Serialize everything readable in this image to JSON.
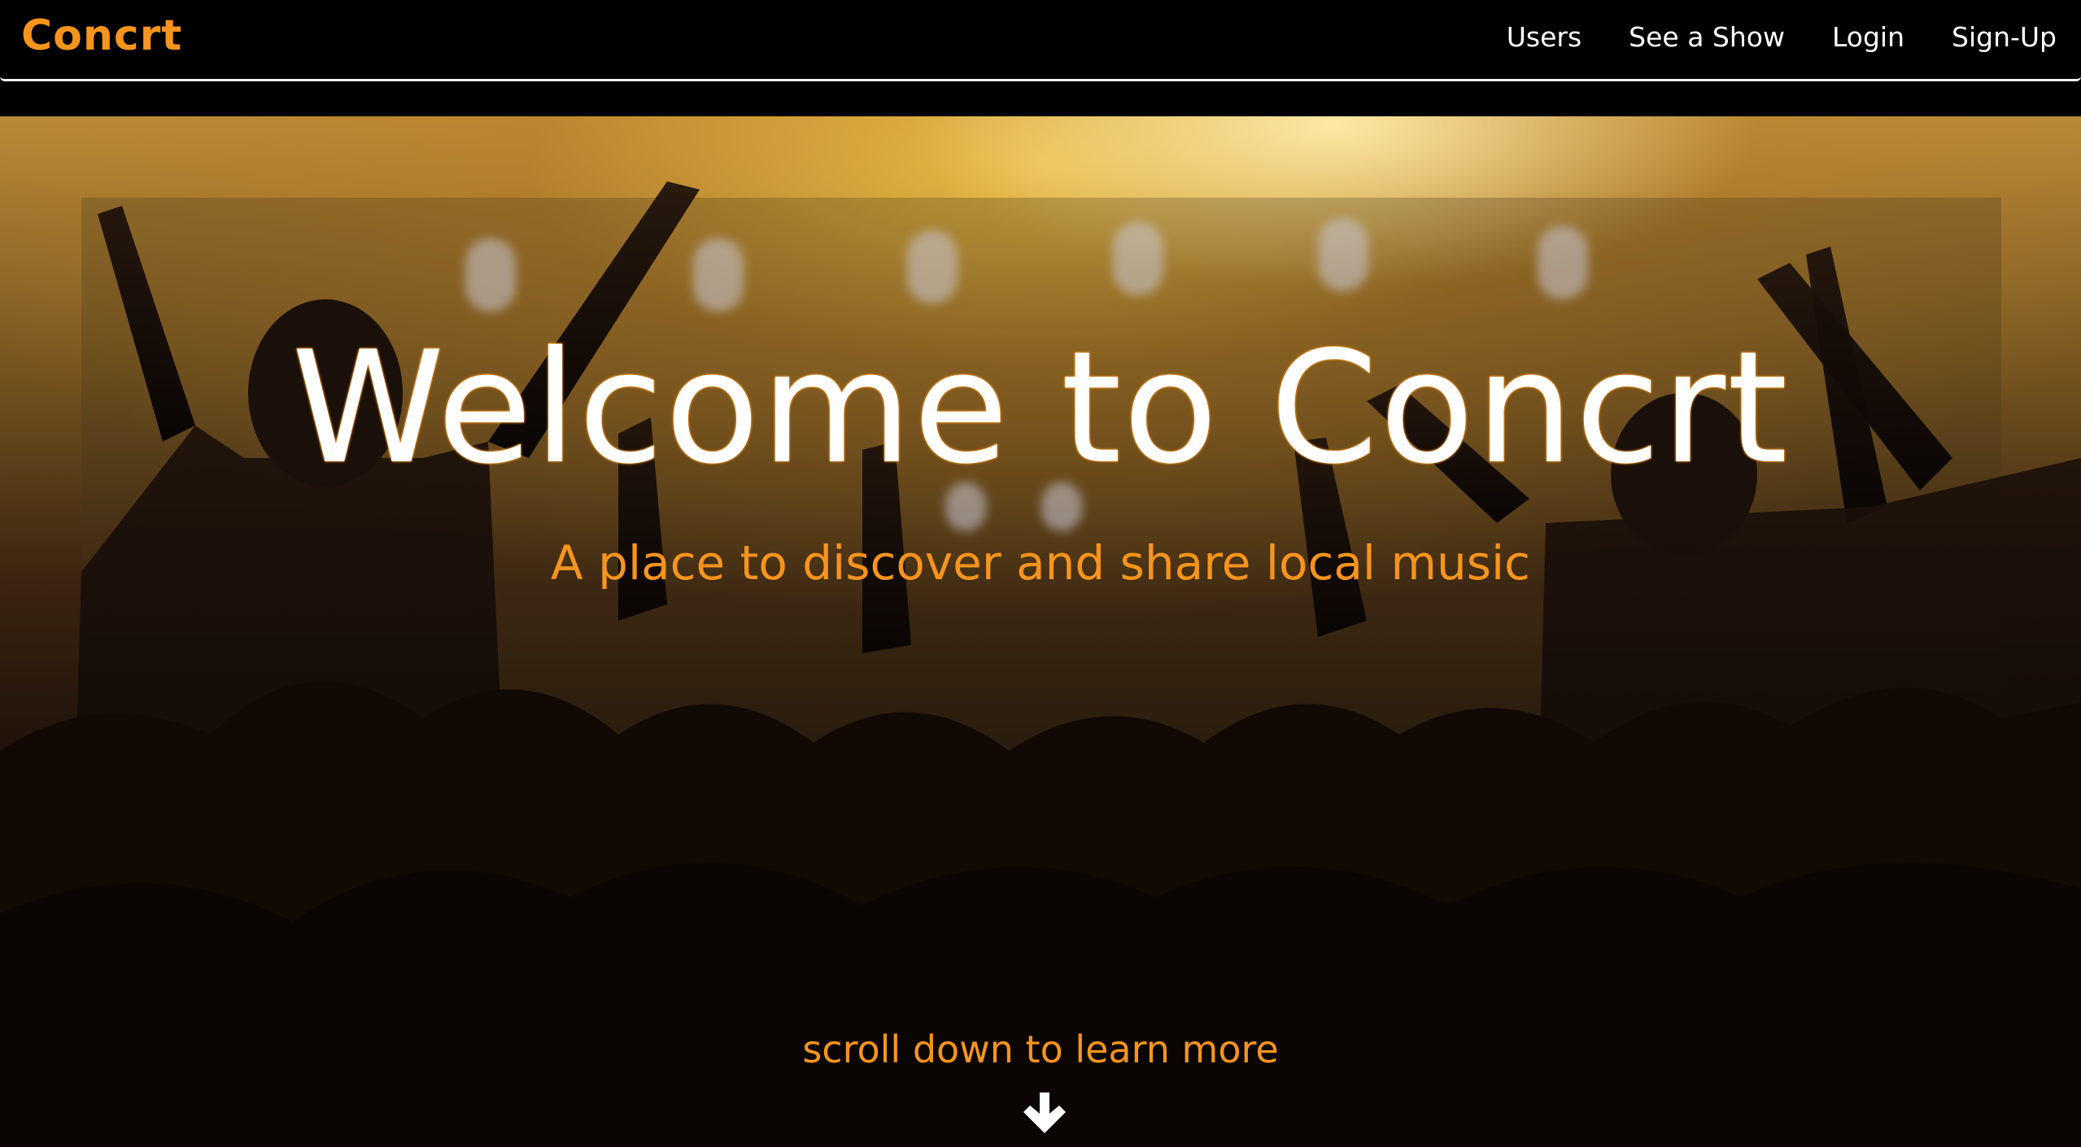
{
  "navbar": {
    "brand": "Concrt",
    "links": [
      {
        "label": "Users"
      },
      {
        "label": "See a Show"
      },
      {
        "label": "Login"
      },
      {
        "label": "Sign-Up"
      }
    ]
  },
  "hero": {
    "title": "Welcome to Concrt",
    "subtitle": "A place to discover and share local music",
    "scroll_prompt": "scroll down to learn more",
    "scroll_icon": "arrow-down-icon",
    "background_image": "concert-crowd-photo"
  },
  "colors": {
    "accent": "#f7941d",
    "navbar_bg": "#000000",
    "nav_text": "#ffffff",
    "title_text": "#ffffff"
  }
}
